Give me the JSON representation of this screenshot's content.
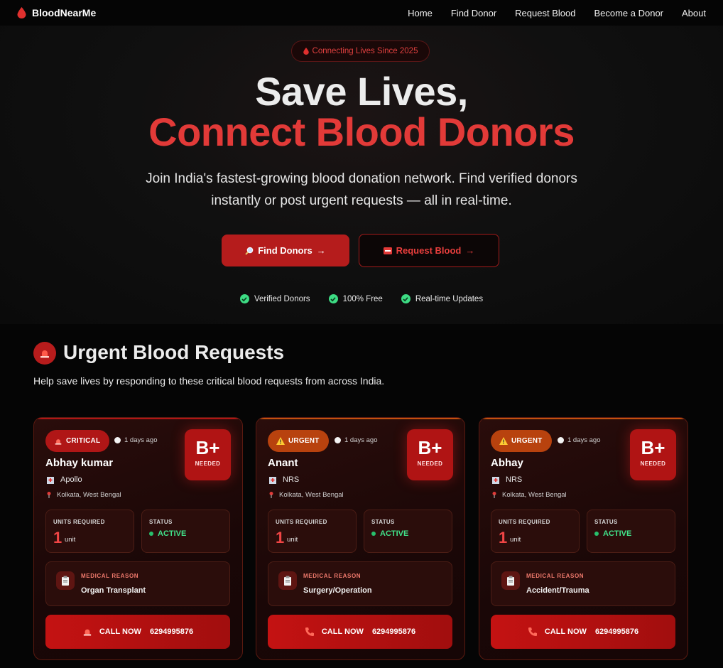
{
  "nav": {
    "brand": "BloodNearMe",
    "links": [
      "Home",
      "Find Donor",
      "Request Blood",
      "Become a Donor",
      "About"
    ]
  },
  "hero": {
    "pill": "Connecting Lives Since 2025",
    "title_line1": "Save Lives,",
    "title_line2": "Connect Blood Donors",
    "subtitle": "Join India's fastest-growing blood donation network. Find verified donors instantly or post urgent requests — all in real-time.",
    "find_button": "Find Donors",
    "request_button": "Request Blood",
    "features": [
      "Verified Donors",
      "100% Free",
      "Real-time Updates"
    ]
  },
  "urgent": {
    "title": "Urgent Blood Requests",
    "subtitle": "Help save lives by responding to these critical blood requests from across India.",
    "units_label": "UNITS REQUIRED",
    "status_label": "STATUS",
    "reason_label": "MEDICAL REASON",
    "needed_label": "NEEDED",
    "call_label": "CALL NOW",
    "cards": [
      {
        "badge": "CRITICAL",
        "time": "1 days ago",
        "name": "Abhay kumar",
        "hospital": "Apollo",
        "location": "Kolkata, West Bengal",
        "blood_type": "B+",
        "units": "1",
        "unit_text": "unit",
        "status": "ACTIVE",
        "reason": "Organ Transplant",
        "phone": "6294995876"
      },
      {
        "badge": "URGENT",
        "time": "1 days ago",
        "name": "Anant",
        "hospital": "NRS",
        "location": "Kolkata, West Bengal",
        "blood_type": "B+",
        "units": "1",
        "unit_text": "unit",
        "status": "ACTIVE",
        "reason": "Surgery/Operation",
        "phone": "6294995876"
      },
      {
        "badge": "URGENT",
        "time": "1 days ago",
        "name": "Abhay",
        "hospital": "NRS",
        "location": "Kolkata, West Bengal",
        "blood_type": "B+",
        "units": "1",
        "unit_text": "unit",
        "status": "ACTIVE",
        "reason": "Accident/Trauma",
        "phone": "6294995876"
      }
    ]
  },
  "colors": {
    "accent_red": "#e23a38",
    "critical": "#b01616",
    "urgent": "#b8420e",
    "active_green": "#41e28a"
  }
}
